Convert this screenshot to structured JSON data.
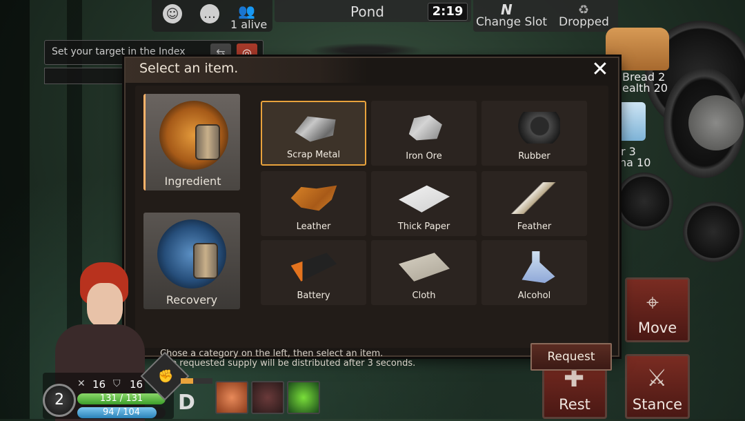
{
  "hud": {
    "alive_count": "1 alive",
    "location": "Pond",
    "timer": "2:19",
    "change_slot_label": "Change Slot",
    "dropped_label": "Dropped"
  },
  "target": {
    "placeholder": "Set your target in the Index"
  },
  "modal": {
    "title": "Select an item.",
    "categories": [
      {
        "label": "Ingredient",
        "active": true
      },
      {
        "label": "Recovery",
        "active": false
      }
    ],
    "items": [
      {
        "label": "Scrap Metal",
        "selected": true,
        "icon": "scrap-metal-icon"
      },
      {
        "label": "Iron Ore",
        "selected": false,
        "icon": "iron-ore-icon"
      },
      {
        "label": "Rubber",
        "selected": false,
        "icon": "rubber-icon"
      },
      {
        "label": "Leather",
        "selected": false,
        "icon": "leather-icon"
      },
      {
        "label": "Thick Paper",
        "selected": false,
        "icon": "thick-paper-icon"
      },
      {
        "label": "Feather",
        "selected": false,
        "icon": "feather-icon"
      },
      {
        "label": "Battery",
        "selected": false,
        "icon": "battery-icon"
      },
      {
        "label": "Cloth",
        "selected": false,
        "icon": "cloth-icon"
      },
      {
        "label": "Alcohol",
        "selected": false,
        "icon": "alcohol-icon"
      }
    ],
    "hint_line1": "Chose a category on the left, then select an item.",
    "hint_line2": "The requested supply will be distributed after 3 seconds.",
    "request_label": "Request"
  },
  "inventory": {
    "bread_name": "Bread 2",
    "bread_stat": "Health 20",
    "water_name": "r 3",
    "water_stat": "na 10"
  },
  "actions": {
    "move": "Move",
    "rest": "Rest",
    "stance": "Stance"
  },
  "player": {
    "level": "2",
    "attack": "16",
    "defense": "16",
    "hp": "131 / 131",
    "sp": "94 / 104",
    "hp_fraction": 1.0,
    "sp_fraction": 0.9,
    "rank": "D"
  },
  "colors": {
    "accent": "#e9a33c",
    "hp": "#5fbf4a",
    "sp": "#4aa3d8",
    "action": "#7a2c22"
  }
}
